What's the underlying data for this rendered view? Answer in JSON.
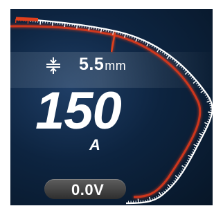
{
  "thickness": {
    "value": "5.5",
    "unit": "mm",
    "icon": "thickness-icon"
  },
  "current": {
    "value": "150",
    "unit": "A"
  },
  "voltage": {
    "value": "0.0V"
  },
  "gauge": {
    "level": 0.35,
    "accent_color": "#e0401d",
    "track_color": "#ffffff"
  }
}
